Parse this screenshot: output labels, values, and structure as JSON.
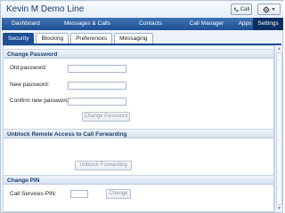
{
  "header": {
    "title": "Kevin M Demo Line",
    "call_label": "Call",
    "call_icon": "phone-icon",
    "settings_icon": "gear-icon"
  },
  "nav": {
    "items": [
      {
        "label": "Dashboard",
        "active": false
      },
      {
        "label": "Messages & Calls",
        "active": false
      },
      {
        "label": "Contacts",
        "active": false
      },
      {
        "label": "Call Manager",
        "active": false
      },
      {
        "label": "Apps",
        "active": false
      },
      {
        "label": "Settings",
        "active": true
      }
    ]
  },
  "subtabs": {
    "items": [
      {
        "label": "Security",
        "active": true
      },
      {
        "label": "Blocking",
        "active": false
      },
      {
        "label": "Preferences",
        "active": false
      },
      {
        "label": "Messaging",
        "active": false
      }
    ]
  },
  "change_password": {
    "title": "Change Password",
    "old_label": "Old password:",
    "new_label": "New password:",
    "confirm_label": "Confirm new password:",
    "button": "Change Password"
  },
  "unblock": {
    "title": "Unblock Remote Access to Call Forwarding",
    "button": "Unblock Forwarding"
  },
  "change_pin": {
    "title": "Change PIN",
    "pin_label": "Call Services PIN:",
    "button": "Change"
  },
  "colors": {
    "nav_bg": "#1d4f93",
    "nav_active": "#0c2f62",
    "section_title": "#1b3f6d"
  }
}
